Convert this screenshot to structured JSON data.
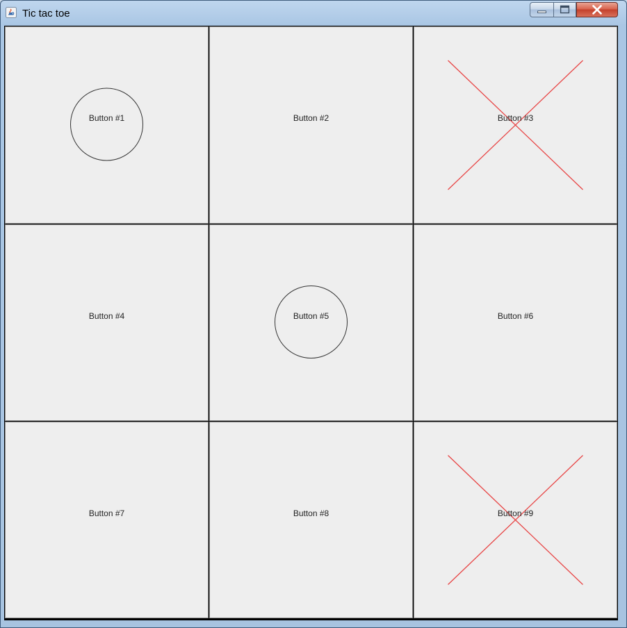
{
  "window": {
    "title": "Tic tac toe",
    "controls": {
      "minimize": "minimize",
      "maximize": "maximize",
      "close": "close"
    }
  },
  "board": {
    "colors": {
      "o_mark": "#333333",
      "x_mark": "#e84545",
      "cell_bg": "#eeeeee"
    },
    "cells": [
      {
        "label": "Button #1",
        "mark": "O"
      },
      {
        "label": "Button #2",
        "mark": ""
      },
      {
        "label": "Button #3",
        "mark": "X"
      },
      {
        "label": "Button #4",
        "mark": ""
      },
      {
        "label": "Button #5",
        "mark": "O"
      },
      {
        "label": "Button #6",
        "mark": ""
      },
      {
        "label": "Button #7",
        "mark": ""
      },
      {
        "label": "Button #8",
        "mark": ""
      },
      {
        "label": "Button #9",
        "mark": "X"
      }
    ]
  }
}
